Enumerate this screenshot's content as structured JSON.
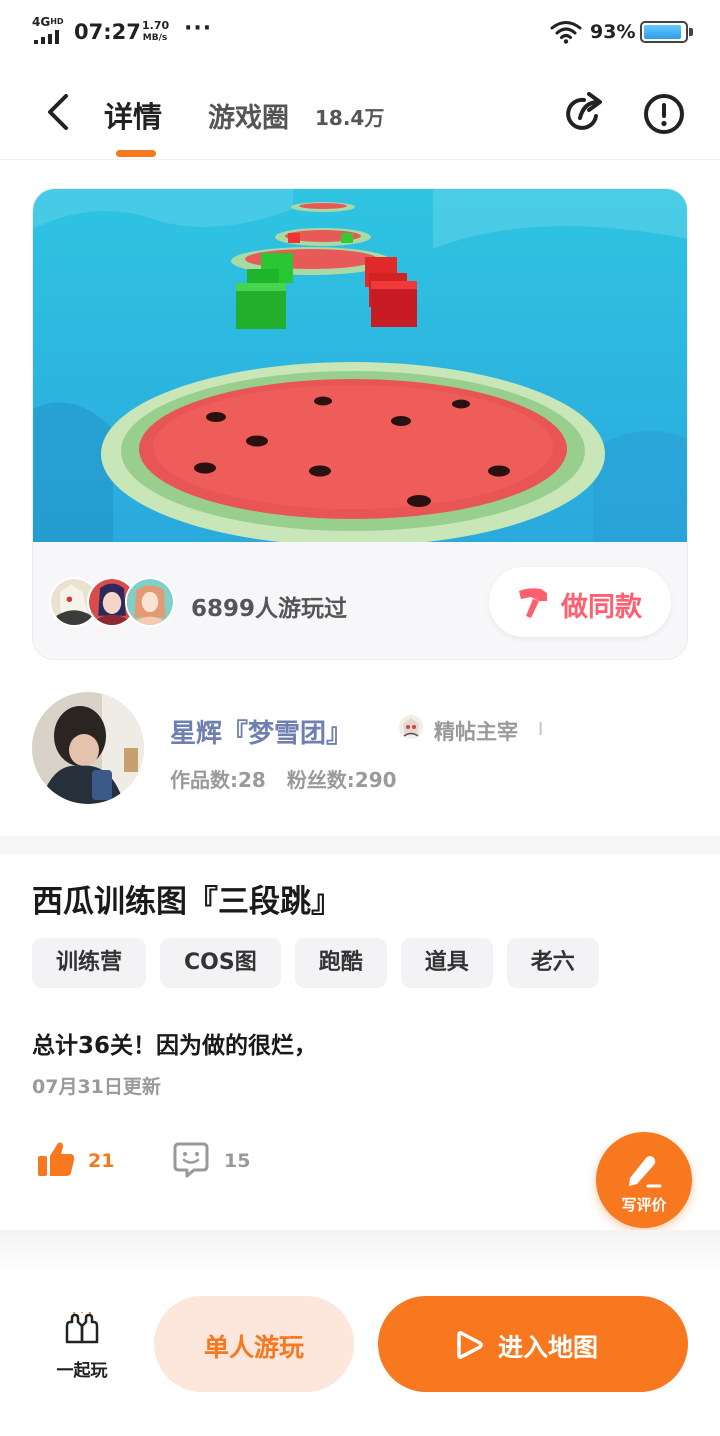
{
  "status_bar": {
    "network": "4G",
    "network_sup": "HD",
    "time": "07:27",
    "speed_value": "1.70",
    "speed_unit": "MB/s",
    "more": "···",
    "battery": "93%",
    "battery_level": 0.93
  },
  "nav": {
    "tab_detail": "详情",
    "tab_circle": "游戏圈",
    "circle_count": "18.4万"
  },
  "map_card": {
    "played_text": "6899人游玩过",
    "same_button": "做同款"
  },
  "author": {
    "name": "星辉『梦雪团』",
    "badge": "精帖主宰",
    "badge_sep": "I",
    "works": "作品数:28",
    "fans": "粉丝数:290"
  },
  "post": {
    "title": "西瓜训练图『三段跳』",
    "tags": [
      "训练营",
      "COS图",
      "跑酷",
      "道具",
      "老六"
    ],
    "description": "总计36关！因为做的很烂，",
    "date": "07月31日更新",
    "likes": "21",
    "comments": "15"
  },
  "review_button": "写评价",
  "bottom_bar": {
    "together": "一起玩",
    "solo": "单人游玩",
    "enter": "进入地图"
  },
  "colors": {
    "accent": "#f7781e",
    "same_button_text": "#ff5f6f",
    "author_name": "#6e7fb0"
  }
}
